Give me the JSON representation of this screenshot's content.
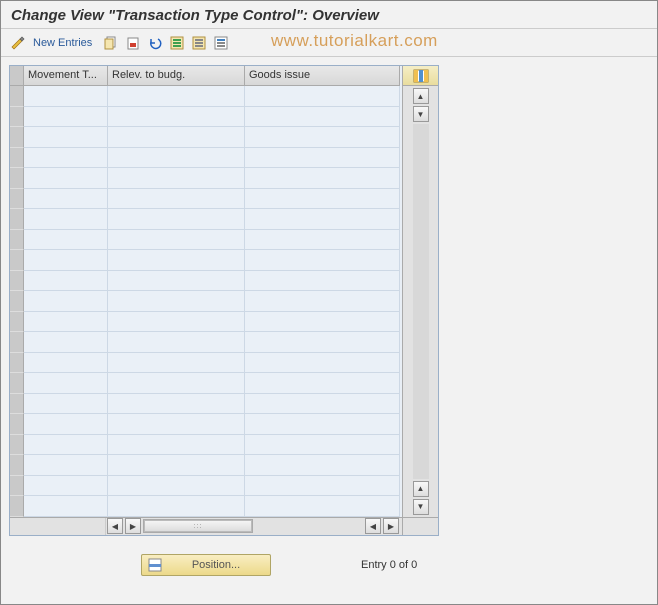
{
  "title": "Change View \"Transaction Type Control\": Overview",
  "toolbar": {
    "new_entries_label": "New Entries",
    "icons": {
      "toggle": "toggle-edit-icon",
      "copy": "copy-icon",
      "delete": "delete-icon",
      "undo": "undo-icon",
      "select_all": "select-all-icon",
      "deselect": "deselect-all-icon",
      "table_settings": "save-icon"
    }
  },
  "watermark": "www.tutorialkart.com",
  "table": {
    "columns": [
      "Movement T...",
      "Relev. to budg.",
      "Goods issue"
    ],
    "rows_visible": 21,
    "config_icon": "table-config-icon"
  },
  "footer": {
    "position_label": "Position...",
    "entry_text": "Entry 0 of 0"
  }
}
